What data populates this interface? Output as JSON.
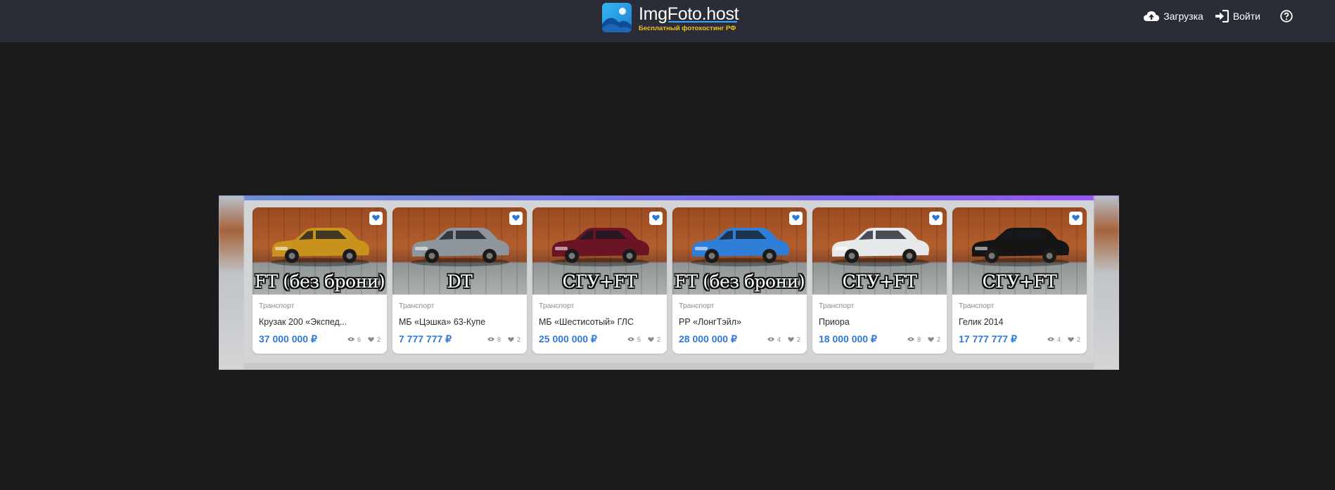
{
  "header": {
    "logo_name": "ImgFoto.host",
    "logo_tagline": "Бесплатный фотохостинг РФ",
    "nav": {
      "upload_label": "Загрузка",
      "login_label": "Войти"
    }
  },
  "listings": [
    {
      "caption": "FT (без брони)",
      "category": "Транспорт",
      "title": "Крузак 200 «Экспед...",
      "price": "37 000 000 ₽",
      "views": "6",
      "likes": "2",
      "car_color": "#c9921c"
    },
    {
      "caption": "DT",
      "category": "Транспорт",
      "title": "МБ «Цэшка» 63-Купе",
      "price": "7 777 777 ₽",
      "views": "8",
      "likes": "2",
      "car_color": "#8f959c"
    },
    {
      "caption": "СГУ+FT",
      "category": "Транспорт",
      "title": "МБ «Шестисотый» ГЛС",
      "price": "25 000 000 ₽",
      "views": "5",
      "likes": "2",
      "car_color": "#6a1426"
    },
    {
      "caption": "FT (без брони)",
      "category": "Транспорт",
      "title": "РР «ЛонгТэйл»",
      "price": "28 000 000 ₽",
      "views": "4",
      "likes": "2",
      "car_color": "#2f7fd9"
    },
    {
      "caption": "СГУ+FT",
      "category": "Транспорт",
      "title": "Приора",
      "price": "18 000 000 ₽",
      "views": "8",
      "likes": "2",
      "car_color": "#e6e8ea"
    },
    {
      "caption": "СГУ+FT",
      "category": "Транспорт",
      "title": "Гелик 2014",
      "price": "17 777 777 ₽",
      "views": "4",
      "likes": "2",
      "car_color": "#151515"
    }
  ]
}
